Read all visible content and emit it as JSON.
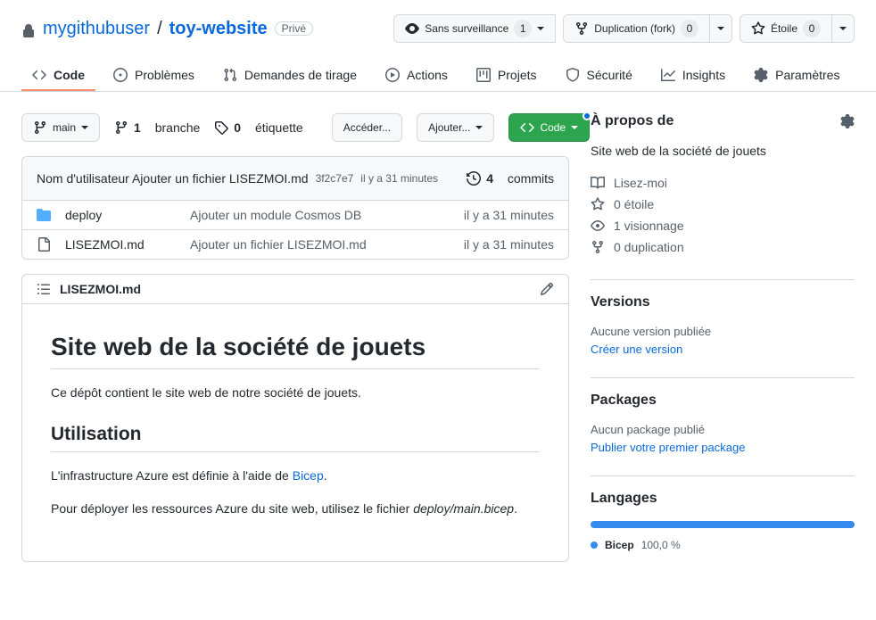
{
  "header": {
    "owner": "mygithubuser",
    "repo": "toy-website",
    "separator": "/",
    "visibility": "Privé"
  },
  "header_actions": {
    "watch": {
      "label": "Sans surveillance",
      "count": "1"
    },
    "fork": {
      "label": "Duplication (fork)",
      "count": "0"
    },
    "star": {
      "label": "Étoile",
      "count": "0"
    }
  },
  "nav": [
    {
      "label": "Code"
    },
    {
      "label": "Problèmes"
    },
    {
      "label": "Demandes de tirage"
    },
    {
      "label": "Actions"
    },
    {
      "label": "Projets"
    },
    {
      "label": "Sécurité"
    },
    {
      "label": "Insights"
    },
    {
      "label": "Paramètres"
    }
  ],
  "toolbar": {
    "branch": "main",
    "branches": {
      "count": "1",
      "label": "branche"
    },
    "tags": {
      "count": "0",
      "label": "étiquette"
    },
    "goto": "Accéder...",
    "add": "Ajouter...",
    "code": "Code"
  },
  "commit": {
    "author": "Nom d'utilisateur",
    "message": "Ajouter un fichier LISEZMOI.md",
    "sha": "3f2c7e7",
    "time": "il y a 31 minutes",
    "count": "4",
    "count_label": "commits"
  },
  "files": [
    {
      "type": "dir",
      "name": "deploy",
      "msg": "Ajouter un module Cosmos DB",
      "time": "il y a 31 minutes"
    },
    {
      "type": "file",
      "name": "LISEZMOI.md",
      "msg": "Ajouter un fichier LISEZMOI.md",
      "time": "il y a 31 minutes"
    }
  ],
  "readme": {
    "filename": "LISEZMOI.md",
    "h1": "Site web de la société de jouets",
    "p1": "Ce dépôt contient le site web de notre société de jouets.",
    "h2": "Utilisation",
    "p2a": "L'infrastructure Azure est définie à l'aide de ",
    "p2_link": "Bicep",
    "p2b": ".",
    "p3a": "Pour déployer les ressources Azure du site web, utilisez le fichier ",
    "p3_em": "deploy/main.bicep",
    "p3b": "."
  },
  "about": {
    "title": "À propos de",
    "desc": "Site web de la société de jouets",
    "items": {
      "readme": "Lisez-moi",
      "stars": "0 étoile",
      "watching": "1 visionnage",
      "forks": "0 duplication"
    }
  },
  "releases": {
    "title": "Versions",
    "note": "Aucune version publiée",
    "link": "Créer une version"
  },
  "packages": {
    "title": "Packages",
    "note": "Aucun package publié",
    "link": "Publier votre premier package"
  },
  "languages": {
    "title": "Langages",
    "items": [
      {
        "name": "Bicep",
        "pct": "100,0 %",
        "color": "#368aee"
      }
    ]
  }
}
